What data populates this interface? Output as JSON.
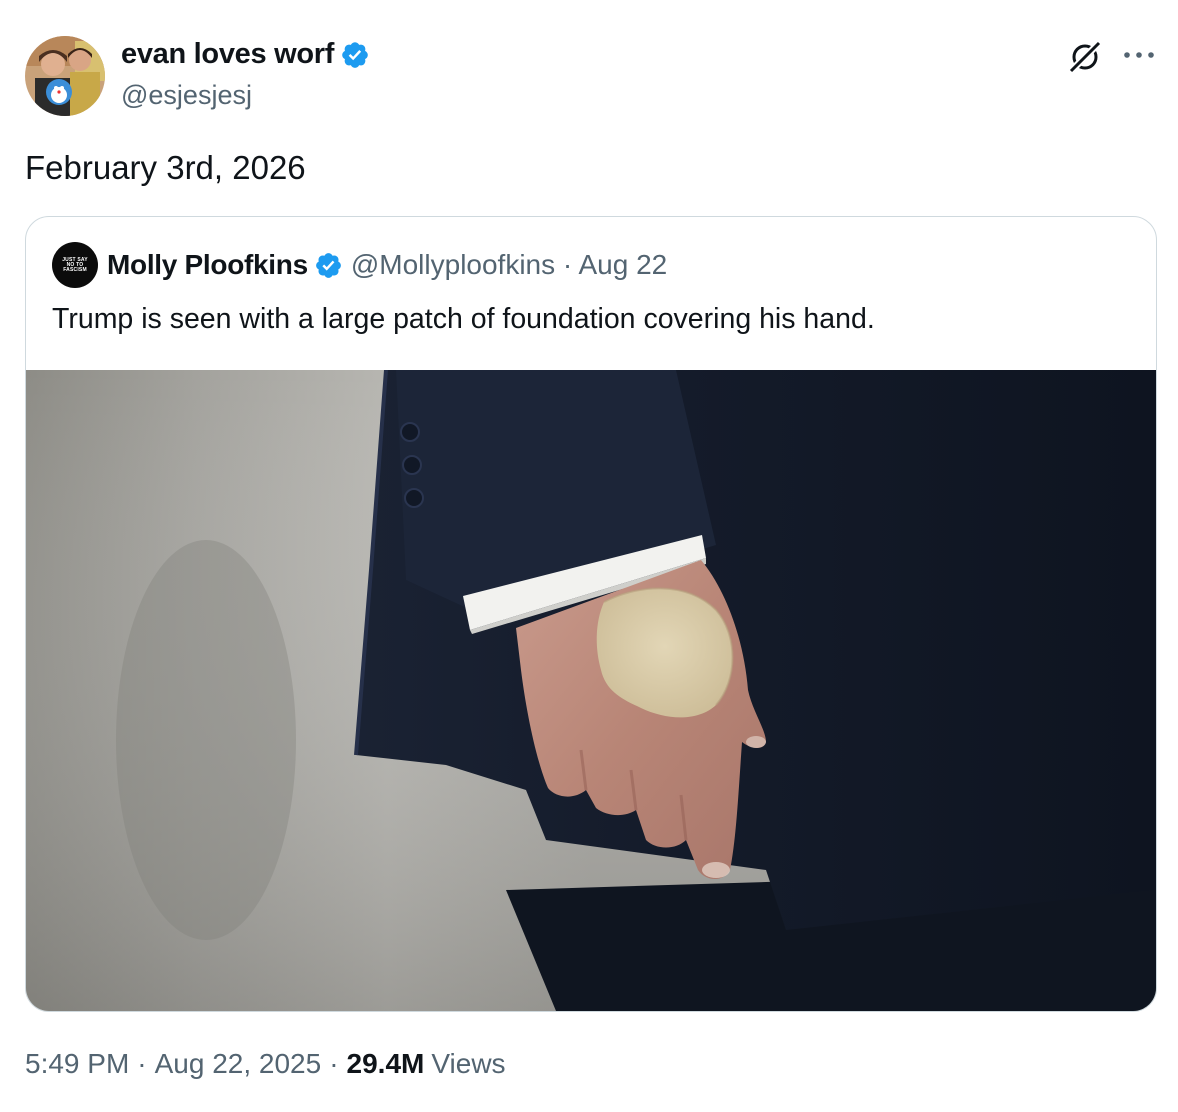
{
  "author": {
    "display_name": "evan loves worf",
    "handle": "@esjesjesj",
    "verified_icon": "verified-badge-icon"
  },
  "actions": {
    "grok_icon": "grok-icon",
    "more_icon": "more-dots-icon"
  },
  "tweet": {
    "text": "February 3rd, 2026"
  },
  "quoted": {
    "display_name": "Molly Ploofkins",
    "handle_and_time": "@Mollyploofkins · Aug 22",
    "text": "Trump is seen with a large patch of foundation covering his hand.",
    "avatar_text": "JUST SAY NO TO FASCISM"
  },
  "meta": {
    "time": "5:49 PM",
    "sep1": "·",
    "date": "Aug 22, 2025",
    "sep2": "·",
    "views_count": "29.4M",
    "views_label": "Views"
  },
  "colors": {
    "verified": "#1d9bf0",
    "secondary_text": "#536471",
    "border": "#cfd9de"
  }
}
